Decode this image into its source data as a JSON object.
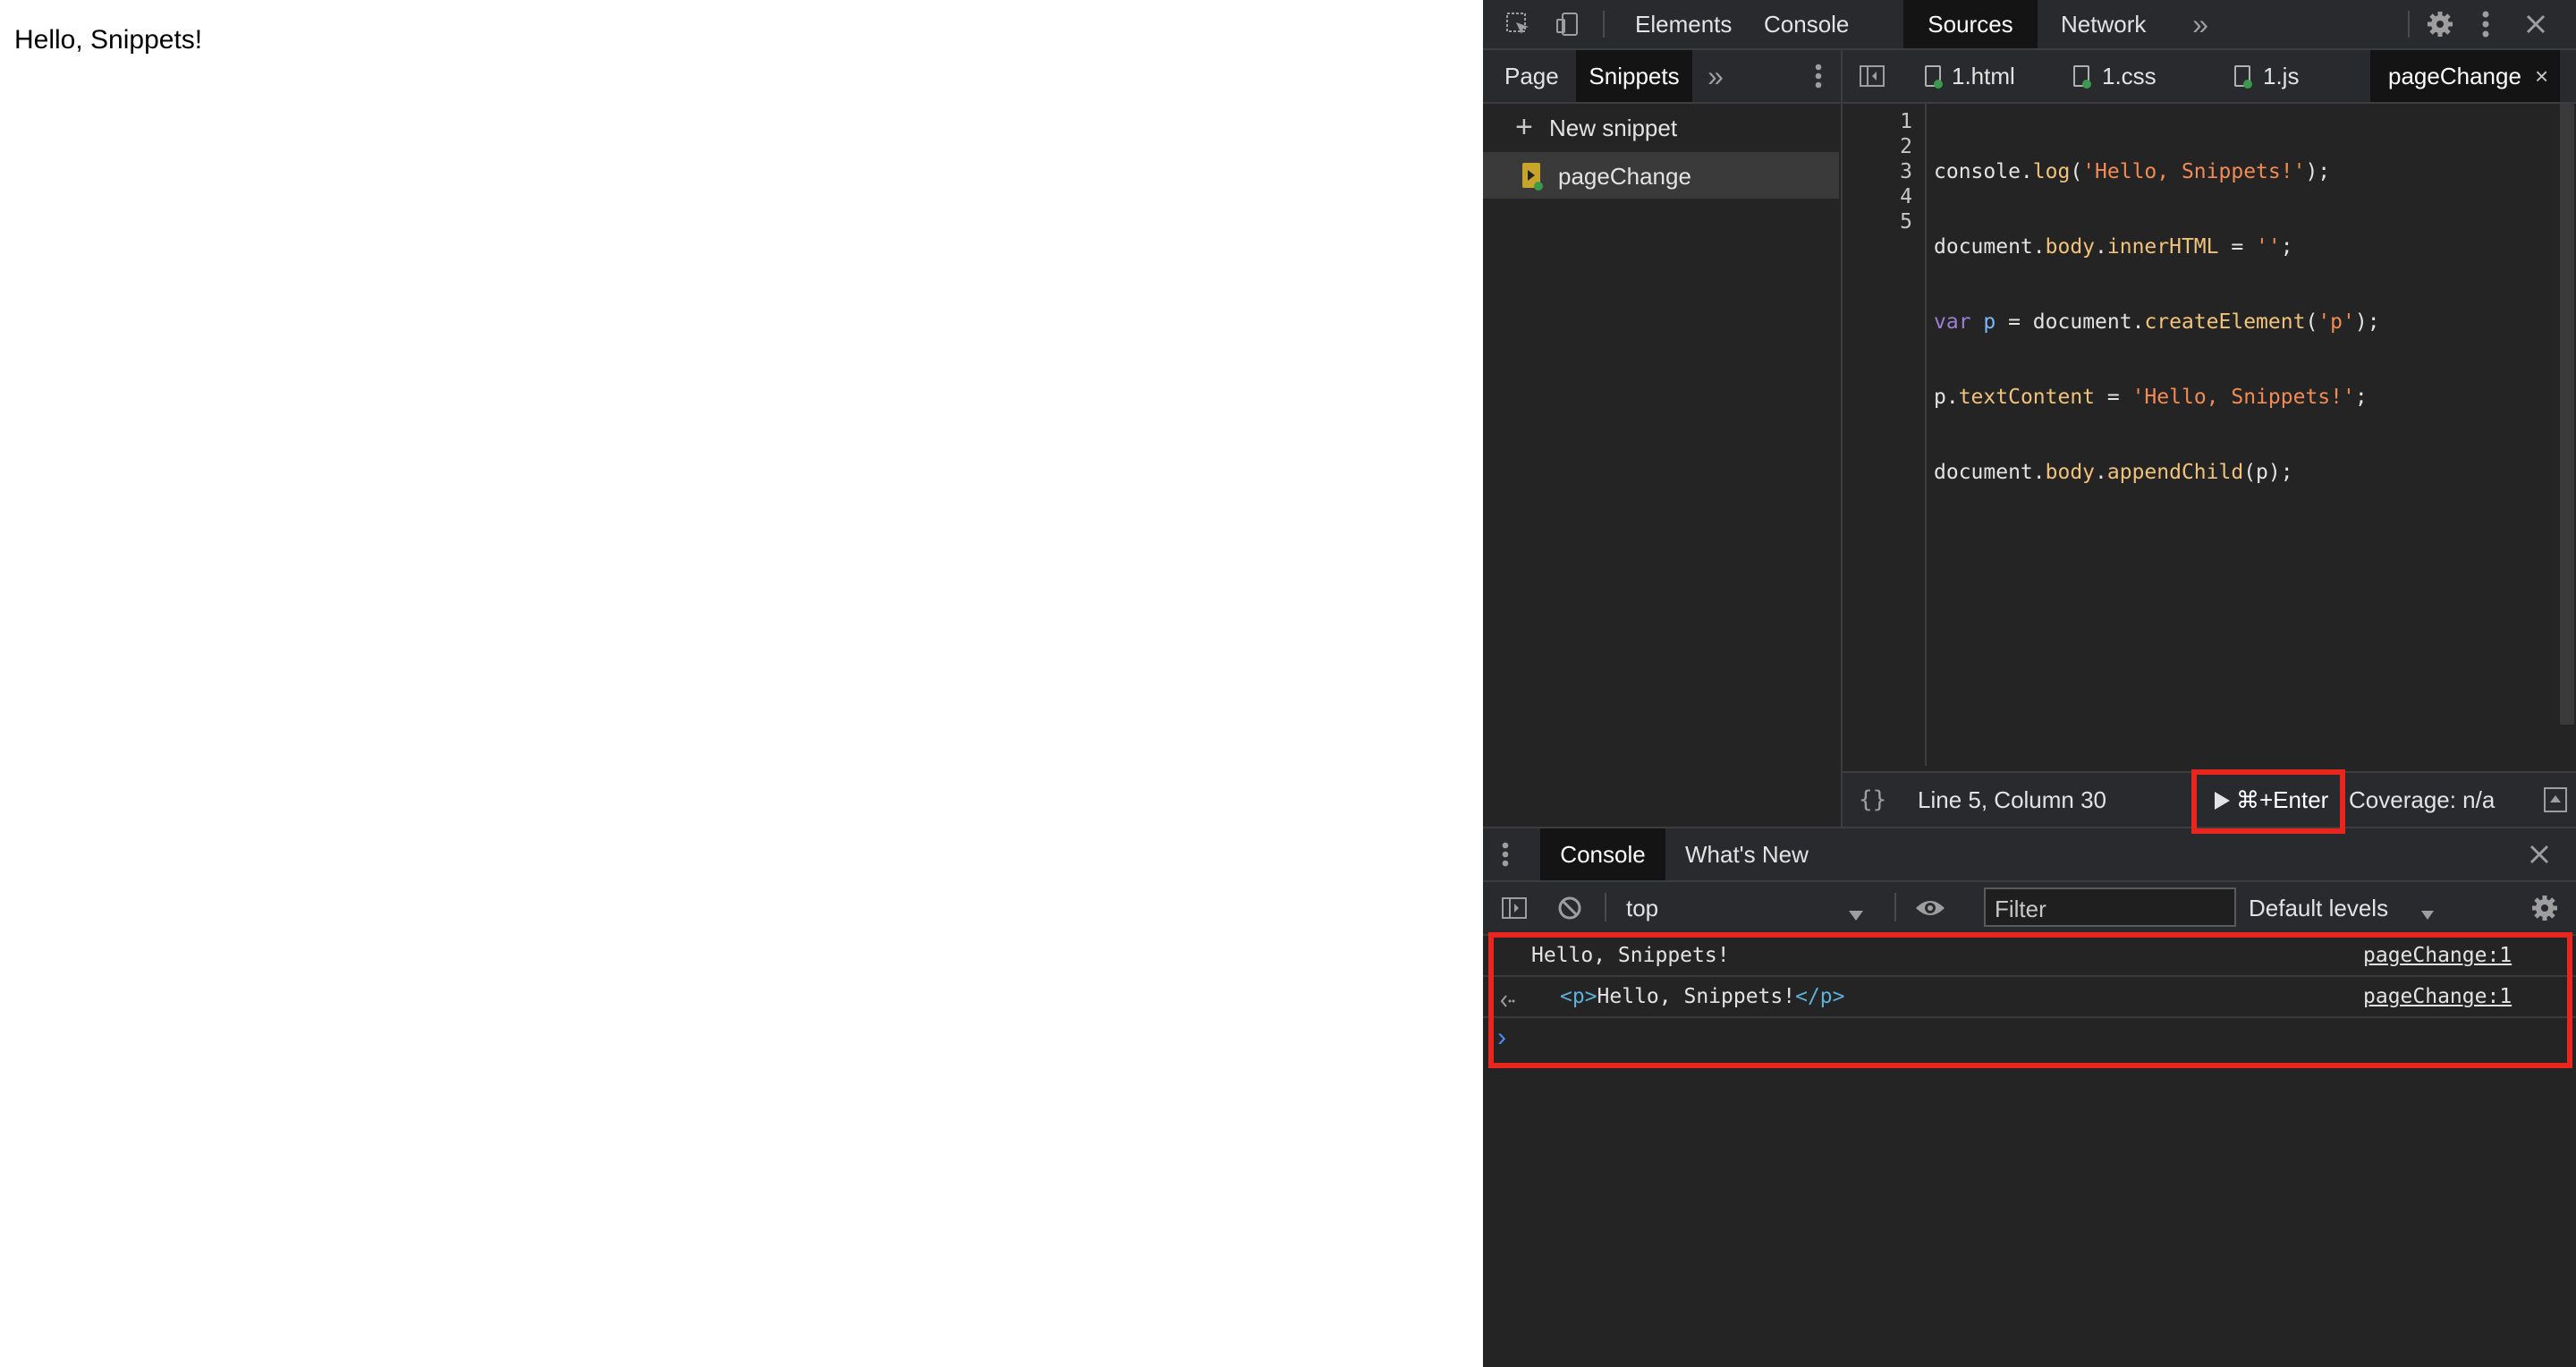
{
  "page": {
    "text": "Hello, Snippets!"
  },
  "toolbar": {
    "tabs": [
      {
        "label": "Elements"
      },
      {
        "label": "Console"
      },
      {
        "label": "Sources"
      },
      {
        "label": "Network"
      }
    ],
    "more_label": "»"
  },
  "navigator": {
    "tabs": [
      {
        "label": "Page"
      },
      {
        "label": "Snippets"
      }
    ],
    "more_label": "»",
    "new_snippet_label": "New snippet",
    "snippets": [
      {
        "name": "pageChange"
      }
    ]
  },
  "editor": {
    "tabs": [
      {
        "label": "1.html"
      },
      {
        "label": "1.css"
      },
      {
        "label": "1.js"
      },
      {
        "label": "pageChange"
      }
    ],
    "line_numbers": [
      "1",
      "2",
      "3",
      "4",
      "5"
    ],
    "code_tokens": {
      "l1a": "console.",
      "l1b": "log",
      "l1c": "(",
      "l1d": "'Hello, Snippets!'",
      "l1e": ");",
      "l2a": "document.",
      "l2b": "body",
      "l2c": ".",
      "l2d": "innerHTML",
      "l2e": " = ",
      "l2f": "''",
      "l2g": ";",
      "l3a": "var",
      "l3b": " ",
      "l3c": "p",
      "l3d": " = document.",
      "l3e": "createElement",
      "l3f": "(",
      "l3g": "'p'",
      "l3h": ");",
      "l4a": "p.",
      "l4b": "textContent",
      "l4c": " = ",
      "l4d": "'Hello, Snippets!'",
      "l4e": ";",
      "l5a": "document.",
      "l5b": "body",
      "l5c": ".",
      "l5d": "appendChild",
      "l5e": "(p);"
    },
    "status": {
      "format_label": "{}",
      "cursor_position": "Line 5, Column 30",
      "run_label": "⌘+Enter",
      "coverage": "Coverage: n/a"
    }
  },
  "drawer": {
    "tabs": [
      {
        "label": "Console"
      },
      {
        "label": "What's New"
      }
    ],
    "context": "top",
    "filter_placeholder": "Filter",
    "levels": "Default levels",
    "messages": [
      {
        "text": "Hello, Snippets!",
        "source": "pageChange:1"
      },
      {
        "open": "<p>",
        "text": "Hello, Snippets!",
        "close": "</p>",
        "source": "pageChange:1"
      }
    ],
    "prompt": "›"
  },
  "colors": {
    "highlight": "#e8261e",
    "panel_bg": "#242424",
    "active_tab_bg": "#141414",
    "string_token": "#f28b54",
    "property_token": "#f1c27b",
    "keyword_token": "#9a7fd5"
  }
}
